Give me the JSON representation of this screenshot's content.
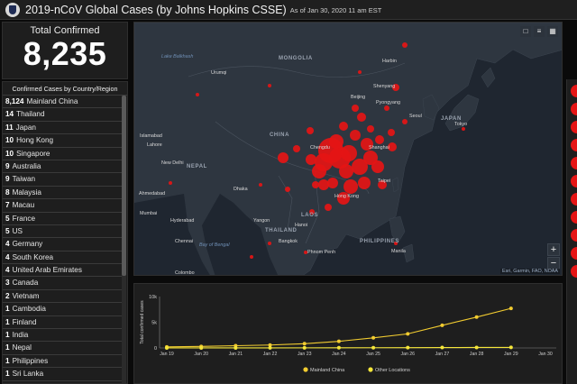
{
  "header": {
    "title": "2019-nCoV Global Cases (by Johns Hopkins CSSE)",
    "as_of": "As of Jan 30, 2020 11 am EST"
  },
  "total": {
    "label": "Total Confirmed",
    "value": "8,235"
  },
  "countries": {
    "heading": "Confirmed Cases by Country/Region",
    "rows": [
      {
        "count": "8,124",
        "name": "Mainland China"
      },
      {
        "count": "14",
        "name": "Thailand"
      },
      {
        "count": "11",
        "name": "Japan"
      },
      {
        "count": "10",
        "name": "Hong Kong"
      },
      {
        "count": "10",
        "name": "Singapore"
      },
      {
        "count": "9",
        "name": "Australia"
      },
      {
        "count": "9",
        "name": "Taiwan"
      },
      {
        "count": "8",
        "name": "Malaysia"
      },
      {
        "count": "7",
        "name": "Macau"
      },
      {
        "count": "5",
        "name": "France"
      },
      {
        "count": "5",
        "name": "US"
      },
      {
        "count": "4",
        "name": "Germany"
      },
      {
        "count": "4",
        "name": "South Korea"
      },
      {
        "count": "4",
        "name": "United Arab Emirates"
      },
      {
        "count": "3",
        "name": "Canada"
      },
      {
        "count": "2",
        "name": "Vietnam"
      },
      {
        "count": "1",
        "name": "Cambodia"
      },
      {
        "count": "1",
        "name": "Finland"
      },
      {
        "count": "1",
        "name": "India"
      },
      {
        "count": "1",
        "name": "Nepal"
      },
      {
        "count": "1",
        "name": "Philippines"
      },
      {
        "count": "1",
        "name": "Sri Lanka"
      }
    ]
  },
  "map": {
    "labels": [
      {
        "text": "Lake Balkhash",
        "kind": "sea"
      },
      {
        "text": "Urumqi",
        "kind": "city"
      },
      {
        "text": "MONGOLIA",
        "kind": "country"
      },
      {
        "text": "Harbin",
        "kind": "city"
      },
      {
        "text": "Shenyang",
        "kind": "city"
      },
      {
        "text": "Beijing",
        "kind": "city"
      },
      {
        "text": "Pyongyang",
        "kind": "city"
      },
      {
        "text": "Seoul",
        "kind": "city"
      },
      {
        "text": "JAPAN",
        "kind": "country"
      },
      {
        "text": "Tokyo",
        "kind": "city"
      },
      {
        "text": "Islamabad",
        "kind": "city"
      },
      {
        "text": "Lahore",
        "kind": "city"
      },
      {
        "text": "CHINA",
        "kind": "country"
      },
      {
        "text": "Shanghai",
        "kind": "city"
      },
      {
        "text": "New Delhi",
        "kind": "city"
      },
      {
        "text": "NEPAL",
        "kind": "country"
      },
      {
        "text": "Chengdu",
        "kind": "city"
      },
      {
        "text": "Taipei",
        "kind": "city"
      },
      {
        "text": "Ahmedabad",
        "kind": "city"
      },
      {
        "text": "Dhaka",
        "kind": "city"
      },
      {
        "text": "Hong Kong",
        "kind": "city"
      },
      {
        "text": "Mumbai",
        "kind": "city"
      },
      {
        "text": "Hyderabad",
        "kind": "city"
      },
      {
        "text": "Yangon",
        "kind": "city"
      },
      {
        "text": "LAOS",
        "kind": "country"
      },
      {
        "text": "Hanoi",
        "kind": "city"
      },
      {
        "text": "THAILAND",
        "kind": "country"
      },
      {
        "text": "Bay of Bengal",
        "kind": "sea"
      },
      {
        "text": "Bangkok",
        "kind": "city"
      },
      {
        "text": "Chennai",
        "kind": "city"
      },
      {
        "text": "Phnom Penh",
        "kind": "city"
      },
      {
        "text": "PHILIPPINES",
        "kind": "country"
      },
      {
        "text": "Manila",
        "kind": "city"
      },
      {
        "text": "Colombo",
        "kind": "city"
      }
    ],
    "zoom_in": "+",
    "zoom_out": "−",
    "attribution": "Esri, Garmin, FAO, NOAA",
    "marker_color": "#e51515"
  },
  "chart_data": {
    "type": "line",
    "ylabel": "Total confirmed cases",
    "yticks": [
      "0",
      "5k",
      "10k"
    ],
    "ylim": [
      0,
      10000
    ],
    "categories": [
      "Jan 19",
      "Jan 20",
      "Jan 21",
      "Jan 22",
      "Jan 23",
      "Jan 24",
      "Jan 25",
      "Jan 26",
      "Jan 27",
      "Jan 28",
      "Jan 29",
      "Jan 30"
    ],
    "series": [
      {
        "name": "Mainland China",
        "color": "#f2cc30",
        "values": [
          200,
          290,
          440,
          570,
          830,
          1290,
          1970,
          2740,
          4400,
          6000,
          7700,
          8124
        ]
      },
      {
        "name": "Other Locations",
        "color": "#f5e63a",
        "values": [
          5,
          6,
          10,
          17,
          20,
          35,
          44,
          56,
          80,
          90,
          100,
          111
        ]
      }
    ],
    "grid": false,
    "legend": "bottom"
  },
  "colors": {
    "background": "#0a0a0a",
    "panel": "#1e1e1e",
    "map": "#232a33",
    "accent": "#e51515",
    "line": "#f2cc30"
  }
}
